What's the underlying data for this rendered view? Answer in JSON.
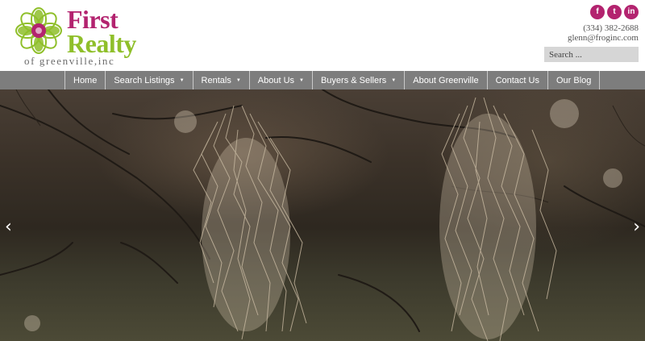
{
  "brand": {
    "line1": "First",
    "line2": "Realty",
    "line3": "of greenville,inc",
    "primary_color": "#b3236f",
    "secondary_color": "#8fbf2a"
  },
  "social": [
    {
      "name": "facebook",
      "glyph": "f"
    },
    {
      "name": "twitter",
      "glyph": "t"
    },
    {
      "name": "linkedin",
      "glyph": "in"
    }
  ],
  "contact": {
    "phone": "(334) 382-2688",
    "email": "glenn@froginc.com"
  },
  "search": {
    "placeholder": "Search ..."
  },
  "nav": {
    "items": [
      {
        "label": "Home",
        "has_dropdown": false
      },
      {
        "label": "Search Listings",
        "has_dropdown": true
      },
      {
        "label": "Rentals",
        "has_dropdown": true
      },
      {
        "label": "About Us",
        "has_dropdown": true
      },
      {
        "label": "Buyers & Sellers",
        "has_dropdown": true
      },
      {
        "label": "About Greenville",
        "has_dropdown": false
      },
      {
        "label": "Contact Us",
        "has_dropdown": false
      },
      {
        "label": "Our Blog",
        "has_dropdown": false
      }
    ],
    "caret": "▼"
  },
  "hero": {
    "prev_arrow": "‹",
    "next_arrow": "›"
  }
}
